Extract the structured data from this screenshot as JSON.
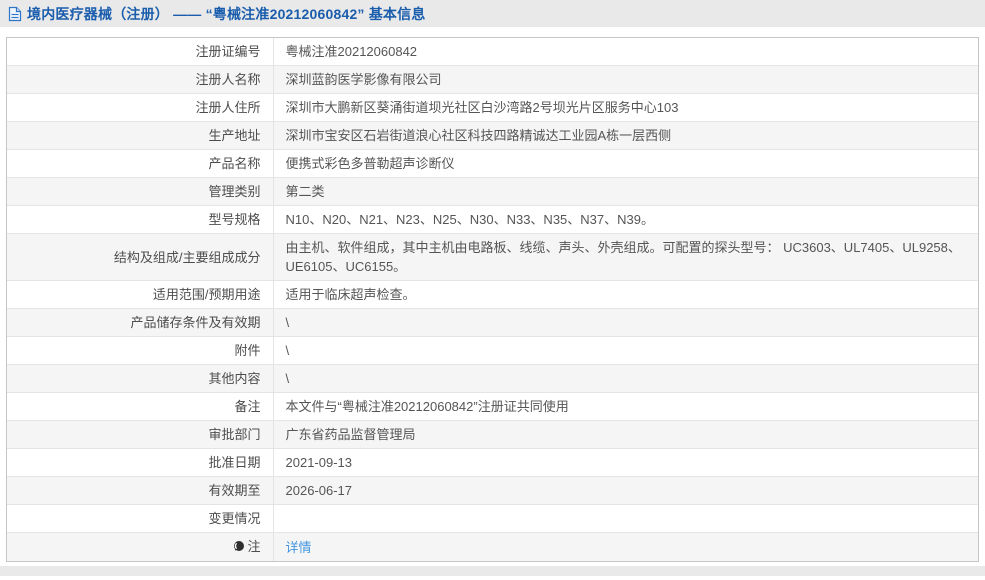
{
  "header": {
    "title": "境内医疗器械（注册） —— “粤械注准20212060842” 基本信息"
  },
  "colors": {
    "title_blue": "#1a5dad",
    "link_blue": "#4296e0",
    "header_bg": "#e9e9e9",
    "row_alt_bg": "#f5f5f5",
    "table_border": "#c6c6c6"
  },
  "table": {
    "rows": [
      {
        "label": "注册证编号",
        "value": "粤械注准20212060842"
      },
      {
        "label": "注册人名称",
        "value": "深圳蓝韵医学影像有限公司"
      },
      {
        "label": "注册人住所",
        "value": "深圳市大鹏新区葵涌街道坝光社区白沙湾路2号坝光片区服务中心103"
      },
      {
        "label": "生产地址",
        "value": "深圳市宝安区石岩街道浪心社区科技四路精诚达工业园A栋一层西侧"
      },
      {
        "label": "产品名称",
        "value": "便携式彩色多普勒超声诊断仪"
      },
      {
        "label": "管理类别",
        "value": "第二类"
      },
      {
        "label": "型号规格",
        "value": "N10、N20、N21、N23、N25、N30、N33、N35、N37、N39。"
      },
      {
        "label": "结构及组成/主要组成成分",
        "value": "由主机、软件组成，其中主机由电路板、线缆、声头、外壳组成。可配置的探头型号： UC3603、UL7405、UL9258、UE6105、UC6155。"
      },
      {
        "label": "适用范围/预期用途",
        "value": "适用于临床超声检查。"
      },
      {
        "label": "产品储存条件及有效期",
        "value": "\\"
      },
      {
        "label": "附件",
        "value": "\\"
      },
      {
        "label": "其他内容",
        "value": "\\"
      },
      {
        "label": "备注",
        "value": "本文件与“粤械注准20212060842”注册证共同使用"
      },
      {
        "label": "审批部门",
        "value": "广东省药品监督管理局"
      },
      {
        "label": "批准日期",
        "value": "2021-09-13"
      },
      {
        "label": "有效期至",
        "value": "2026-06-17"
      },
      {
        "label": "变更情况",
        "value": ""
      },
      {
        "label": "注",
        "value": "详情"
      }
    ]
  }
}
